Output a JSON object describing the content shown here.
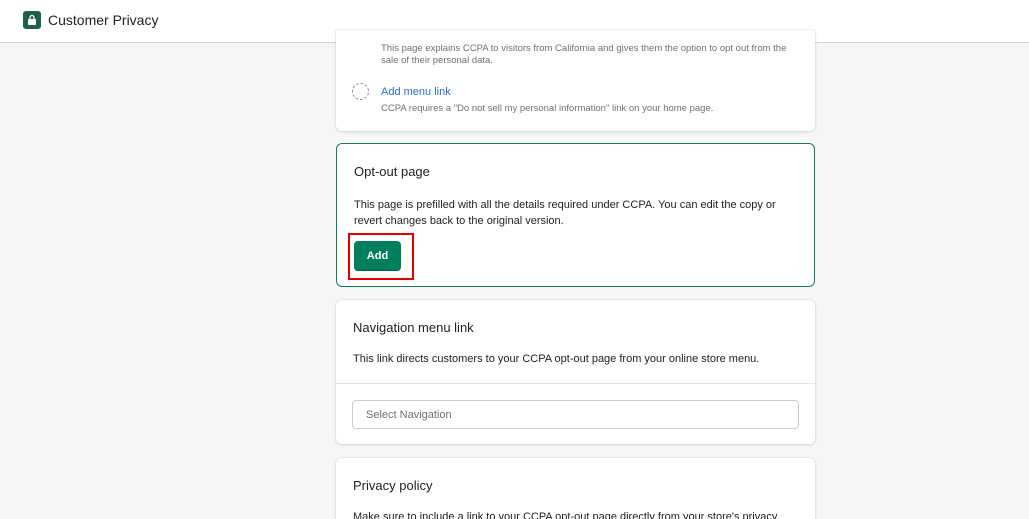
{
  "app": {
    "title": "Customer Privacy",
    "icon": "lock-bag-icon",
    "brand_color": "#1e5e4a"
  },
  "top_card": {
    "description": "This page explains CCPA to visitors from California and gives them the option to opt out from the sale of their personal data.",
    "menu_link_label": "Add menu link",
    "menu_link_description": "CCPA requires a \"Do not sell my personal information\" link on your home page."
  },
  "optout_card": {
    "title": "Opt-out page",
    "description": "This page is prefilled with all the details required under CCPA. You can edit the copy or revert changes back to the original version.",
    "add_label": "Add",
    "accent_color": "#007f5f",
    "highlight_color": "#e00000"
  },
  "nav_card": {
    "title": "Navigation menu link",
    "description": "This link directs customers to your CCPA opt-out page from your online store menu.",
    "select_placeholder": "Select Navigation"
  },
  "privacy_card": {
    "title": "Privacy policy",
    "description": "Make sure to include a link to your CCPA opt-out page directly from your store's privacy"
  }
}
